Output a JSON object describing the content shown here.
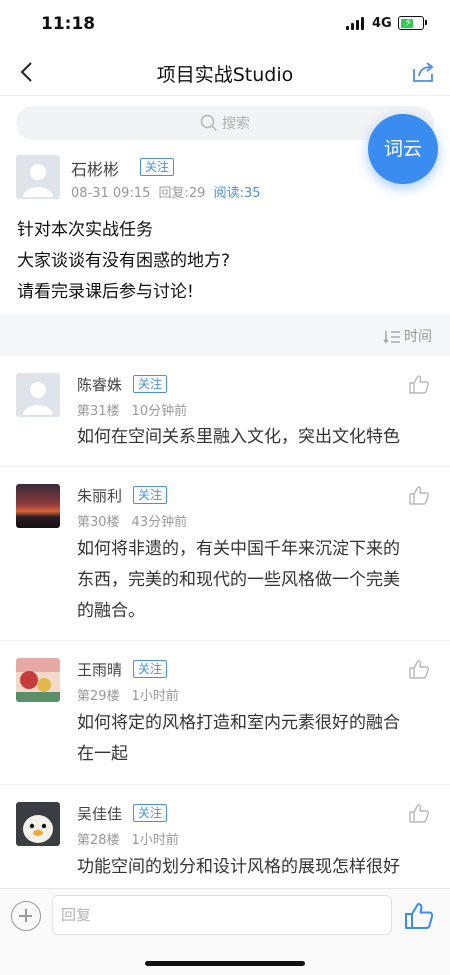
{
  "status_bar": {
    "time": "11:18",
    "network": "4G",
    "battery_level": 0.6
  },
  "nav": {
    "title": "项目实战Studio",
    "back_icon": "chevron-left-icon",
    "share_icon": "share-icon"
  },
  "search": {
    "placeholder": "搜索"
  },
  "wordcloud_label": "词云",
  "post": {
    "author": "石彬彬",
    "follow_label": "关注",
    "date": "08-31 09:15",
    "replies": "回复:29",
    "reads": "阅读:35",
    "body_lines": [
      "针对本次实战任务",
      "大家谈谈有没有困惑的地方?",
      "请看完录课后参与讨论!"
    ]
  },
  "sort_label": "时间",
  "comments": [
    {
      "name": "陈睿姝",
      "follow_label": "关注",
      "floor": "第31楼",
      "time": "10分钟前",
      "text_lines": [
        "如何在空间关系里融入文化，突出文化特色"
      ]
    },
    {
      "name": "朱丽利",
      "follow_label": "关注",
      "floor": "第30楼",
      "time": "43分钟前",
      "text_lines": [
        "如何将非遗的，有关中国千年来沉淀下来的",
        "东西，完美的和现代的一些风格做一个完美",
        "的融合。"
      ]
    },
    {
      "name": "王雨晴",
      "follow_label": "关注",
      "floor": "第29楼",
      "time": "1小时前",
      "text_lines": [
        "如何将定的风格打造和室内元素很好的融合",
        "在一起"
      ]
    },
    {
      "name": "吴佳佳",
      "follow_label": "关注",
      "floor": "第28楼",
      "time": "1小时前",
      "text_lines": [
        "功能空间的划分和设计风格的展现怎样很好"
      ]
    }
  ],
  "reply_bar": {
    "placeholder": "回复"
  },
  "colors": {
    "accent": "#3b8cf0",
    "link": "#4a90e2",
    "battery": "#34c759"
  }
}
